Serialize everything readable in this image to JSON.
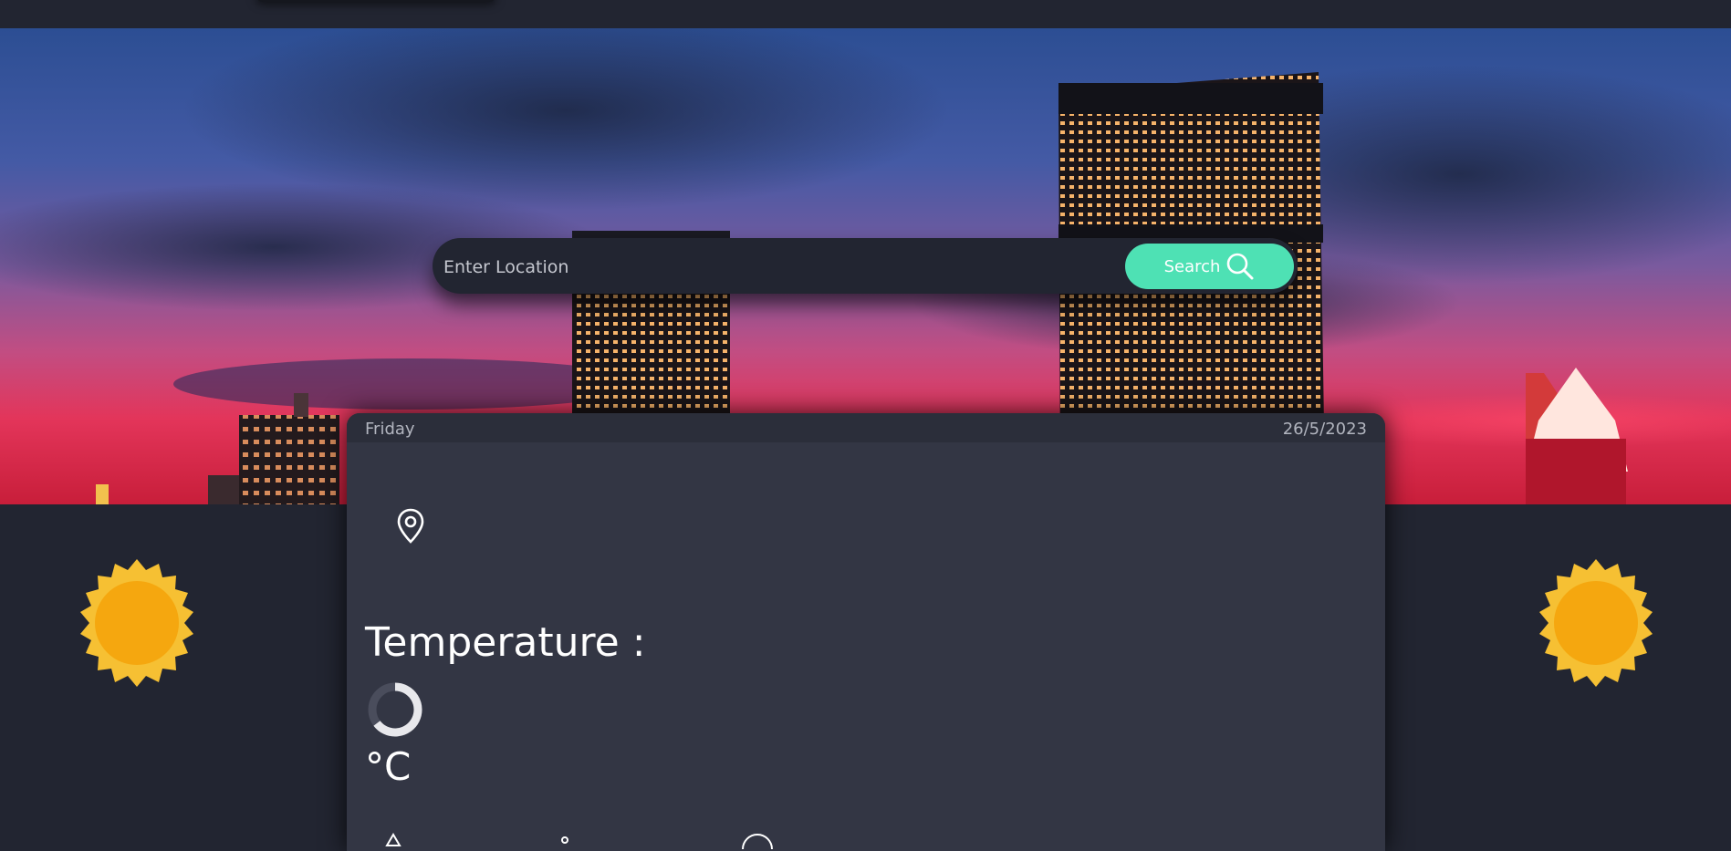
{
  "search": {
    "placeholder": "Enter Location",
    "button_label": "Search"
  },
  "weather_card": {
    "day": "Friday",
    "date": "26/5/2023",
    "temperature_label": "Temperature :",
    "unit": "°C"
  },
  "icons": {
    "search": "magnifier-icon",
    "location": "map-pin-icon",
    "loading": "spinner-icon",
    "decor": "sun-icon"
  },
  "colors": {
    "background": "#222531",
    "card": "#333644",
    "accent": "#4ee1b4",
    "sun": "#f5a70f"
  }
}
